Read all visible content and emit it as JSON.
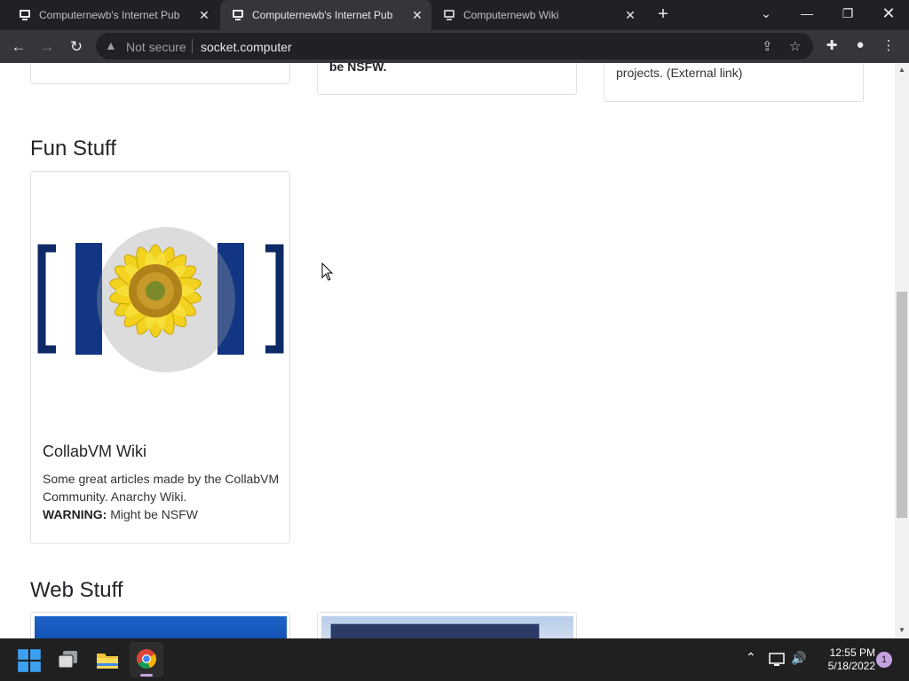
{
  "browser": {
    "tabs": [
      {
        "title": "Computernewb's Internet Pub Hub",
        "active": false
      },
      {
        "title": "Computernewb's Internet Pub Hub",
        "active": true
      },
      {
        "title": "Computernewb Wiki",
        "active": false
      }
    ],
    "security_label": "Not secure",
    "url": "socket.computer"
  },
  "page": {
    "top_cards": {
      "middle_text": "be NSFW.",
      "right_text": "projects. (External link)"
    },
    "sections": [
      {
        "heading": "Fun Stuff",
        "cards": [
          {
            "title": "CollabVM Wiki",
            "description": "Some great articles made by the CollabVM Community. Anarchy Wiki.",
            "warning_label": "WARNING:",
            "warning_text": "Might be NSFW"
          }
        ]
      },
      {
        "heading": "Web Stuff"
      }
    ]
  },
  "taskbar": {
    "time": "12:55 PM",
    "date": "5/18/2022",
    "notification_count": "1"
  },
  "colors": {
    "tab_bar": "#202124",
    "toolbar": "#35363a",
    "taskbar": "#202020",
    "notification_badge": "#c4a1e0"
  }
}
